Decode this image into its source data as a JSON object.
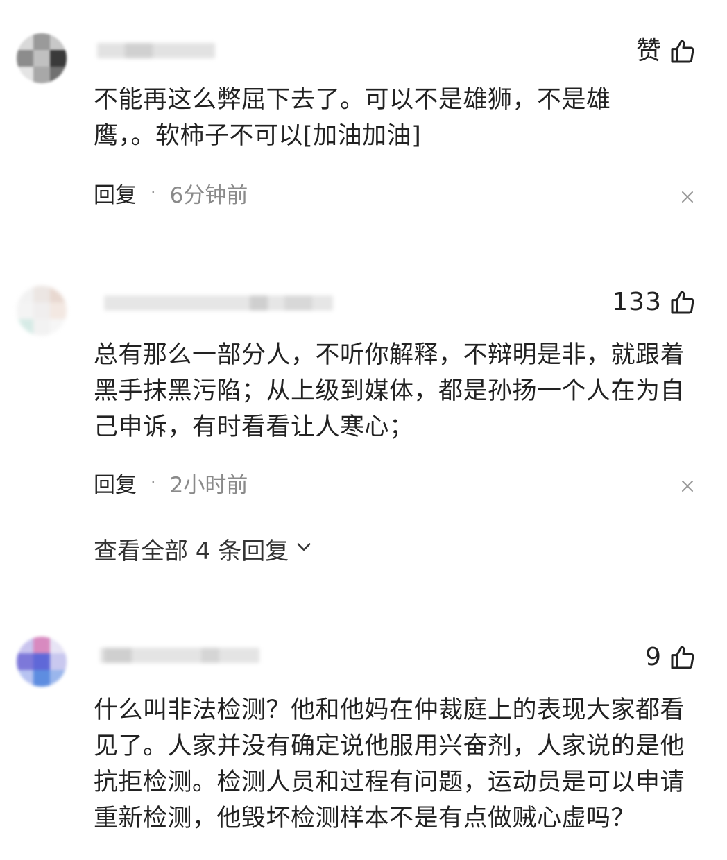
{
  "comments": [
    {
      "like_label": "赞",
      "body": "不能再这么弊屈下去了。可以不是雄狮，不是雄鹰，。软柿子不可以[加油加油]",
      "reply_label": "回复",
      "separator": "·",
      "time": "6分钟前"
    },
    {
      "like_label": "133",
      "body": "总有那么一部分人，不听你解释，不辩明是非，就跟着黑手抹黑污陷；从上级到媒体，都是孙扬一个人在为自己申诉，有时看看让人寒心；",
      "reply_label": "回复",
      "separator": "·",
      "time": "2小时前",
      "view_replies": "查看全部 4 条回复"
    },
    {
      "like_label": "9",
      "body": "什么叫非法检测？他和他妈在仲裁庭上的表现大家都看见了。人家并没有确定说他服用兴奋剂，人家说的是他抗拒检测。检测人员和过程有问题，运动员是可以申请重新检测，他毁坏检测样本不是有点做贼心虚吗？"
    }
  ],
  "icons": {
    "like": "thumbs-up-icon",
    "close": "close-icon",
    "expand": "chevron-down-icon"
  },
  "colors": {
    "text": "#222222",
    "muted": "#8a8a8a"
  }
}
